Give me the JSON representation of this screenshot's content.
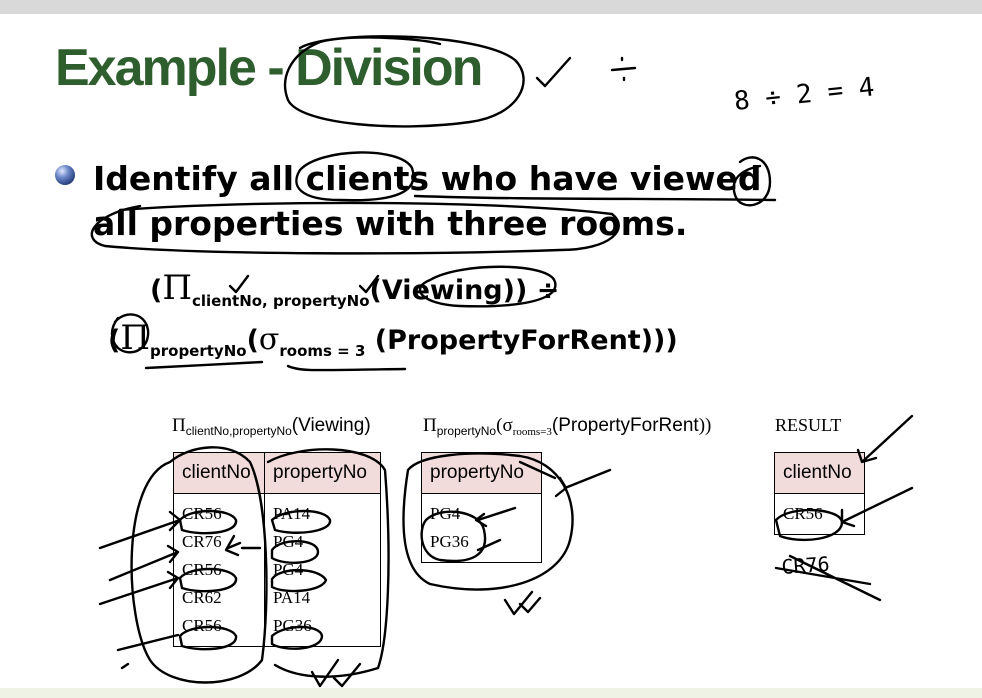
{
  "title": "Example - Division",
  "bullet": "Identify all clients who have viewed all properties with three rooms.",
  "expression": {
    "line1": {
      "open": "(",
      "pi": "Π",
      "sub": "clientNo, propertyNo",
      "arg": "(Viewing))",
      "op": " ÷"
    },
    "line2": {
      "open": "(",
      "pi": "Π",
      "sub": "propertyNo",
      "open2": "(",
      "sigma": "σ",
      "sigma_sub": "rooms = 3",
      "arg": " (PropertyForRent)))"
    }
  },
  "captions": {
    "viewing": {
      "pi": "Π",
      "sub": "clientNo,propertyNo",
      "arg": "(Viewing)"
    },
    "property": {
      "pi": "Π",
      "sub": "propertyNo",
      "open": "(",
      "sigma": "σ",
      "sigma_sub": "rooms=3",
      "arg": "(PropertyForRent",
      "close": "))"
    },
    "result": "RESULT"
  },
  "tables": {
    "viewing": {
      "headers": [
        "clientNo",
        "propertyNo"
      ],
      "rows": [
        [
          "CR56",
          "PA14"
        ],
        [
          "CR76",
          "PG4"
        ],
        [
          "CR56",
          "PG4"
        ],
        [
          "CR62",
          "PA14"
        ],
        [
          "CR56",
          "PG36"
        ]
      ]
    },
    "property": {
      "headers": [
        "propertyNo"
      ],
      "rows": [
        [
          "PG4"
        ],
        [
          "PG36"
        ]
      ]
    },
    "result": {
      "headers": [
        "clientNo"
      ],
      "rows": [
        [
          "CR56"
        ]
      ]
    }
  },
  "annotations": {
    "top_right": "8 ÷ 2 = 4",
    "struck_value": "CR76",
    "divide_sign": "÷"
  },
  "colors": {
    "title": "#2e5e2e",
    "table_header": "#f2dcdb",
    "ink": "#000000"
  }
}
